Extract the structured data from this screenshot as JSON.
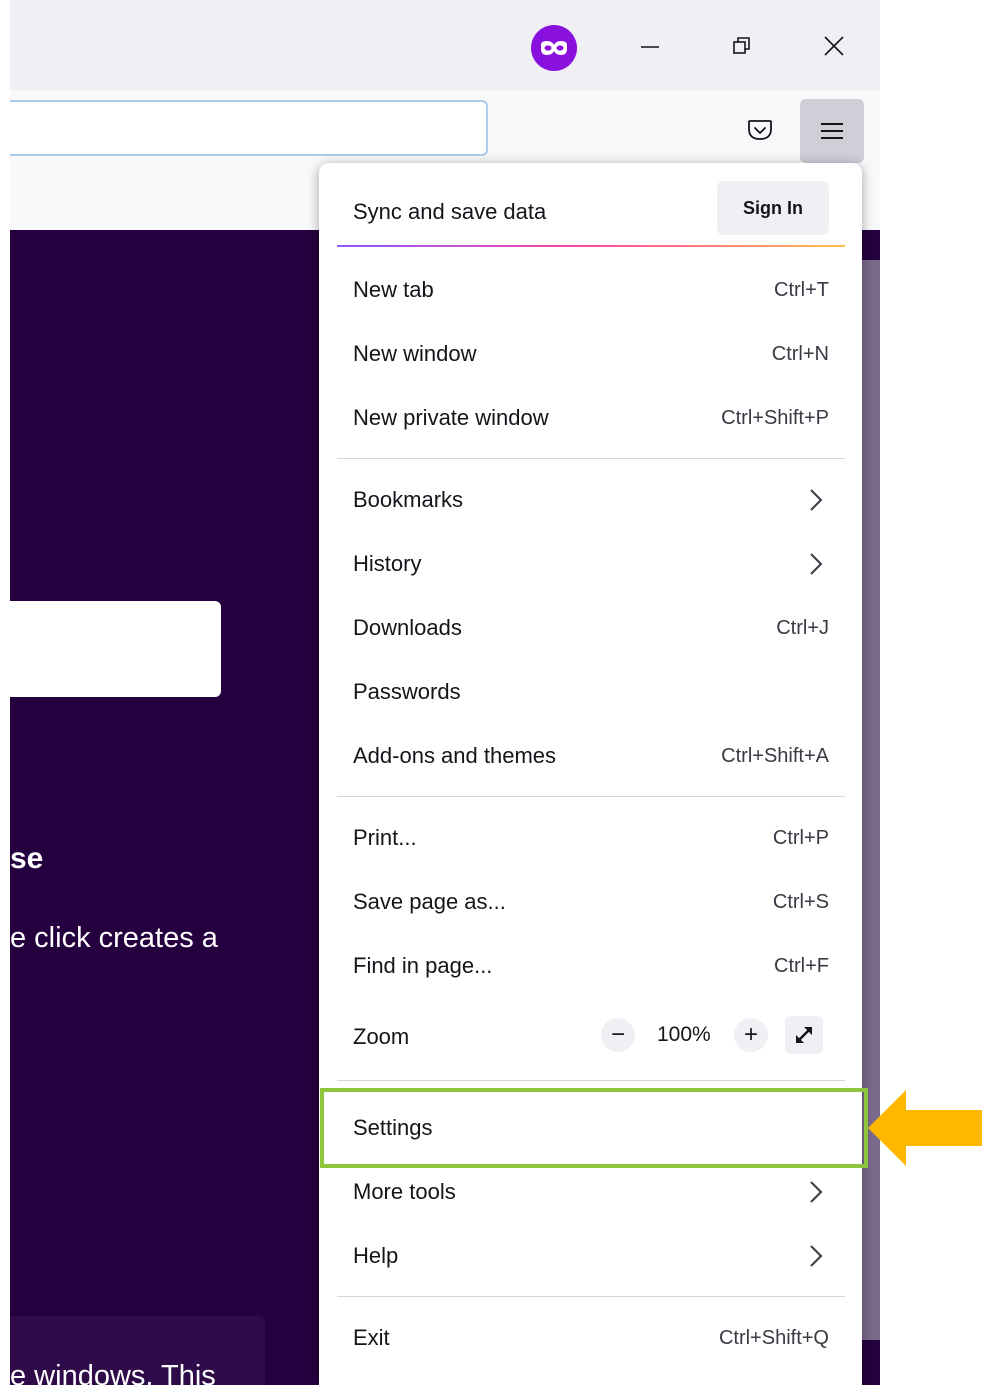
{
  "titlebar": {
    "private_icon": "private-browsing-mask-icon",
    "minimize_icon": "minimize-icon",
    "restore_icon": "restore-icon",
    "close_icon": "close-icon"
  },
  "toolbar": {
    "pocket_icon": "pocket-icon",
    "menu_icon": "hamburger-menu-icon"
  },
  "page": {
    "heading_fragment": "se",
    "body_fragment": "e click creates a",
    "lower_fragment": "e windows. This"
  },
  "menu": {
    "sync_label": "Sync and save data",
    "sign_in_label": "Sign In",
    "items": [
      {
        "label": "New tab",
        "shortcut": "Ctrl+T"
      },
      {
        "label": "New window",
        "shortcut": "Ctrl+N"
      },
      {
        "label": "New private window",
        "shortcut": "Ctrl+Shift+P"
      },
      {
        "label": "Bookmarks",
        "submenu": true
      },
      {
        "label": "History",
        "submenu": true
      },
      {
        "label": "Downloads",
        "shortcut": "Ctrl+J"
      },
      {
        "label": "Passwords"
      },
      {
        "label": "Add-ons and themes",
        "shortcut": "Ctrl+Shift+A"
      },
      {
        "label": "Print...",
        "shortcut": "Ctrl+P"
      },
      {
        "label": "Save page as...",
        "shortcut": "Ctrl+S"
      },
      {
        "label": "Find in page...",
        "shortcut": "Ctrl+F"
      },
      {
        "label": "Settings"
      },
      {
        "label": "More tools",
        "submenu": true
      },
      {
        "label": "Help",
        "submenu": true
      },
      {
        "label": "Exit",
        "shortcut": "Ctrl+Shift+Q"
      }
    ],
    "zoom": {
      "label": "Zoom",
      "minus": "−",
      "value": "100%",
      "plus": "+",
      "fullscreen_icon": "fullscreen-expand-icon"
    }
  },
  "annotation": {
    "highlight_color": "#8dc63f",
    "arrow_color": "#ffb800",
    "arrow_icon": "left-arrow-icon"
  },
  "colors": {
    "page_background": "#25003e",
    "private_badge": "#8a10dd"
  }
}
